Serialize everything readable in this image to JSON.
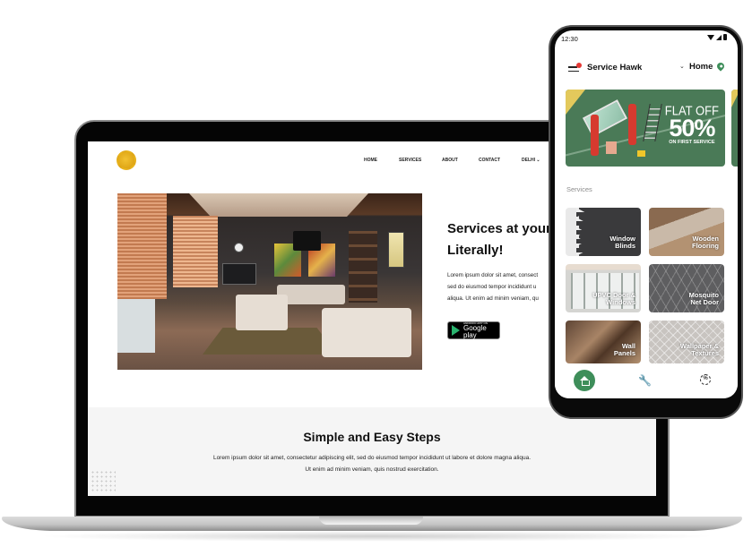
{
  "laptop_site": {
    "logo_icon": "eagle-logo-icon",
    "nav": {
      "home": "HOME",
      "services": "SERVICES",
      "about": "ABOUT",
      "contact": "CONTACT",
      "city": "DELHI",
      "city_chevron": "⌄"
    },
    "hero": {
      "title_line1": "Services at your",
      "title_line2": "Literally!",
      "text_line1": "Lorem ipsum dolor sit amet, consect",
      "text_line2": "sed do eiusmod tempor incididunt u",
      "text_line3": "aliqua. Ut enim ad minim veniam, qu",
      "store_button_small": "ANDROID APP ON",
      "store_button_big": "Google play"
    },
    "steps": {
      "title": "Simple and Easy Steps",
      "text_line1": "Lorem ipsum dolor sit amet, consectetur adipiscing elit, sed do eiusmod tempor incididunt ut labore et dolore magna aliqua.",
      "text_line2": "Ut enim ad minim veniam, quis nostrud exercitation."
    }
  },
  "phone_app": {
    "status_time": "12:30",
    "app_title": "Service Hawk",
    "location_chevron": "⌄",
    "location": "Home",
    "banner": {
      "line1": "FLAT OFF",
      "line2": "50%",
      "line3": "ON FIRST SERVICE"
    },
    "services_label": "Services",
    "services": [
      {
        "line1": "Window",
        "line2": "Blinds"
      },
      {
        "line1": "Wooden",
        "line2": "Flooring"
      },
      {
        "line1": "UPVC Door &",
        "line2": "Windows"
      },
      {
        "line1": "Mosquito",
        "line2": "Net Door"
      },
      {
        "line1": "Wall",
        "line2": "Panels"
      },
      {
        "line1": "Wallpaper &",
        "line2": "Textures"
      }
    ],
    "bottom_nav": {
      "wrench_glyph": "🔧",
      "offers_glyph": "%"
    }
  },
  "colors": {
    "brand_green": "#4a7a57",
    "nav_active_green": "#3e8e5a",
    "notification_red": "#e53935",
    "logo_gold": "#e8b21a"
  }
}
